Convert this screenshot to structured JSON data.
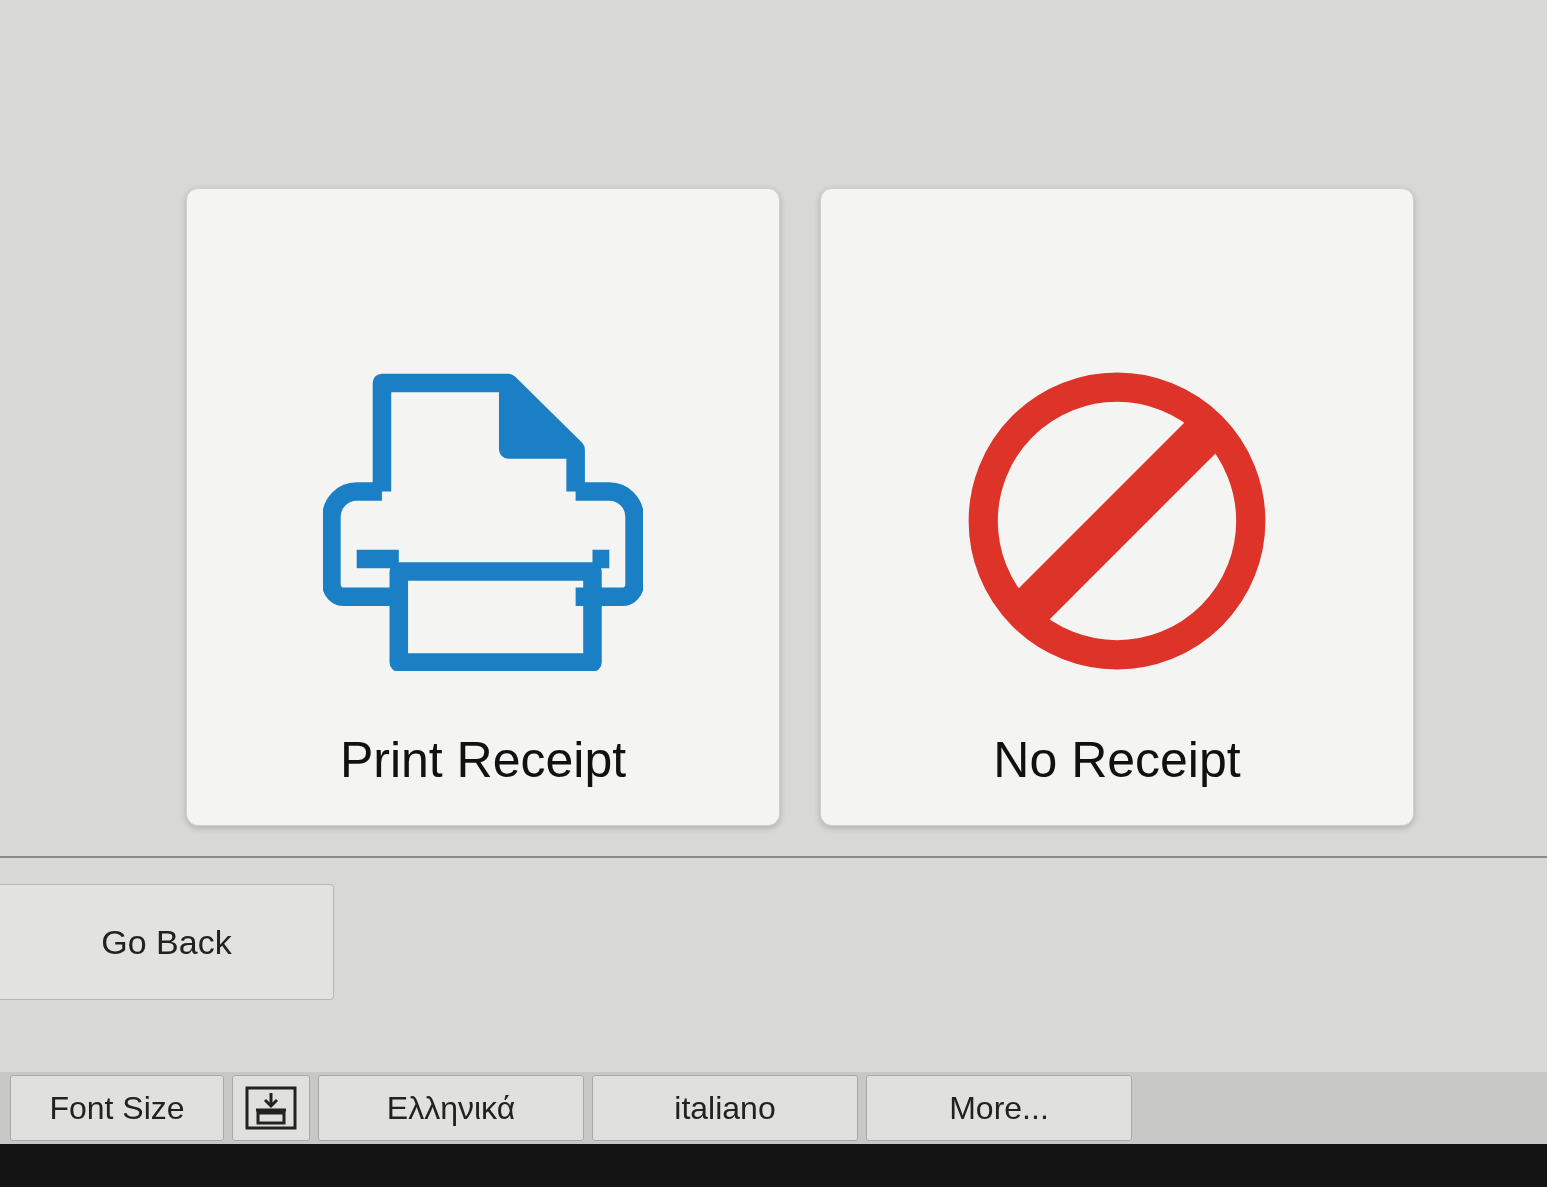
{
  "options": [
    {
      "label": "Print Receipt",
      "kind": "print"
    },
    {
      "label": "No Receipt",
      "kind": "none"
    }
  ],
  "back_button": {
    "label": "Go Back"
  },
  "toolbar": {
    "font_size": {
      "label": "Font Size"
    },
    "languages": [
      "Ελληνικά",
      "italiano",
      "More..."
    ]
  }
}
